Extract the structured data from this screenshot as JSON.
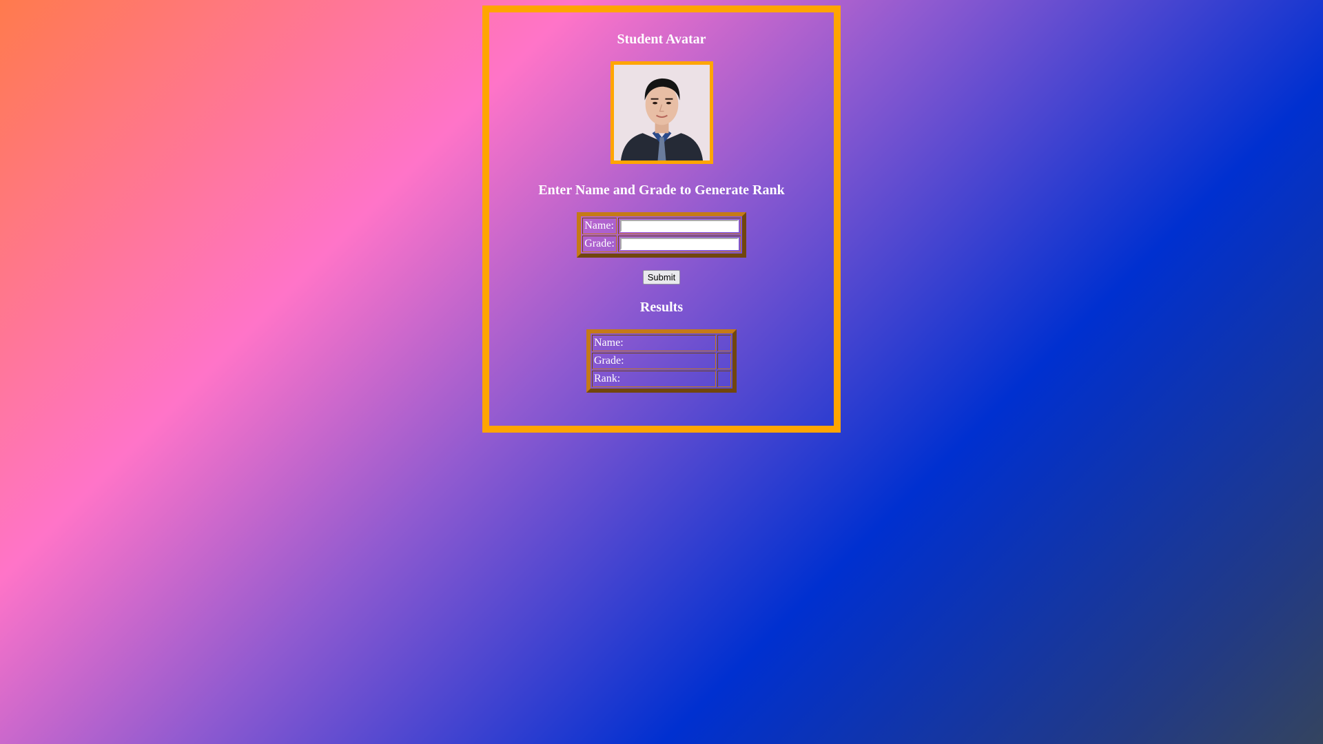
{
  "avatar_section": {
    "title": "Student Avatar"
  },
  "form_section": {
    "title": "Enter Name and Grade to Generate Rank",
    "name_label": "Name:",
    "grade_label": "Grade:",
    "name_value": "",
    "grade_value": "",
    "submit_label": "Submit"
  },
  "results_section": {
    "title": "Results",
    "rows": [
      {
        "label": "Name:",
        "value": ""
      },
      {
        "label": "Grade:",
        "value": ""
      },
      {
        "label": "Rank:",
        "value": ""
      }
    ]
  },
  "colors": {
    "frame_border": "#ffa500",
    "table_border": "#c57a17",
    "text": "#ffffff"
  },
  "icons": {
    "avatar": "student-portrait-photo"
  }
}
